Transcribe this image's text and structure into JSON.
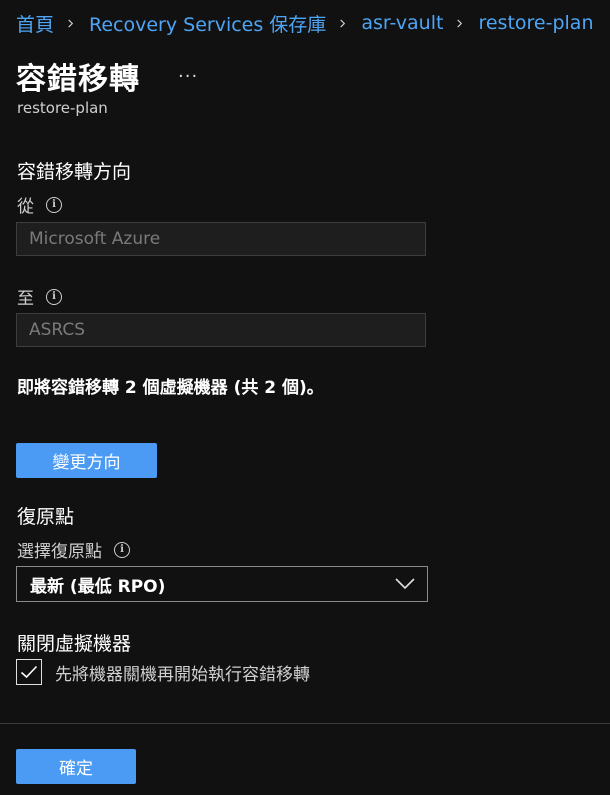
{
  "breadcrumb": {
    "items": [
      "首頁",
      "Recovery Services 保存庫",
      "asr-vault",
      "restore-plan"
    ]
  },
  "header": {
    "title": "容錯移轉",
    "more_label": "···",
    "subtitle": "restore-plan"
  },
  "direction": {
    "heading": "容錯移轉方向",
    "from_label": "從",
    "from_value": "Microsoft Azure",
    "to_label": "至",
    "to_value": "ASRCS",
    "summary": "即將容錯移轉 2 個虛擬機器 (共 2 個)。",
    "change_button": "變更方向"
  },
  "recovery_point": {
    "heading": "復原點",
    "select_label": "選擇復原點",
    "selected": "最新 (最低 RPO)"
  },
  "shutdown": {
    "heading": "關閉虛擬機器",
    "checkbox_label": "先將機器關機再開始執行容錯移轉",
    "checked": true
  },
  "footer": {
    "ok_button": "確定"
  },
  "colors": {
    "accent": "#4b9bf5",
    "link": "#4ea5f5",
    "background": "#111111"
  }
}
